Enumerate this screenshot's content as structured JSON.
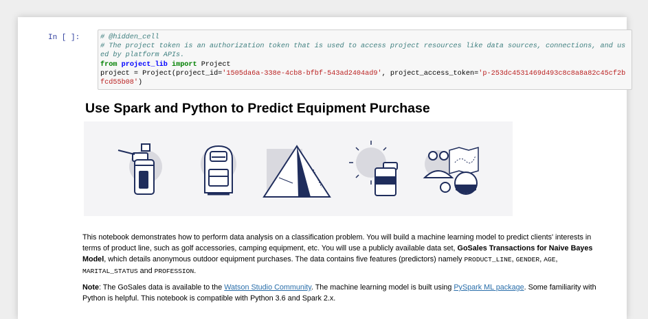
{
  "code_cell": {
    "prompt": "In [ ]:",
    "comment1": "# @hidden_cell",
    "comment2": "# The project token is an authorization token that is used to access project resources like data sources, connections, and used by platform APIs.",
    "kw_from": "from",
    "module": "project_lib",
    "kw_import": "import",
    "import_name": " Project",
    "line4_pre": "project = Project(project_id=",
    "project_id": "'1505da6a-338e-4cb8-bfbf-543ad2404ad9'",
    "line4_mid": ", project_access_token=",
    "token": "'p-253dc4531469d493c8c8a8a82c45cf2bfcd55b08'",
    "line4_end": ")"
  },
  "markdown": {
    "title": "Use Spark and Python to Predict Equipment Purchase",
    "banner_icons": [
      "golf-bag-icon",
      "backpack-icon",
      "tent-icon",
      "sun-lantern-icon",
      "map-binoculars-icon"
    ],
    "para1": {
      "t1": "This notebook demonstrates how to perform data analysis on a classification problem. You will build a machine learning model to predict clients' interests in terms of product line, such as golf accessories, camping equipment, etc. You will use a publicly available data set, ",
      "bold": "GoSales Transactions for Naive Bayes Model",
      "t2": ", which details anonymous outdoor equipment purchases. The data contains five features (predictors) namely ",
      "f1": "PRODUCT_LINE",
      "sep1": ", ",
      "f2": "GENDER",
      "sep2": ", ",
      "f3": "AGE",
      "sep3": ", ",
      "f4": "MARITAL_STATUS",
      "and": " and ",
      "f5": "PROFESSION",
      "end": "."
    },
    "para2": {
      "note": "Note",
      "t1": ": The GoSales data is available to the ",
      "link1": "Watson Studio Community",
      "t2": ". The machine learning model is built using ",
      "link2": "PySpark ML package",
      "t3": ". Some familiarity with Python is helpful. This notebook is compatible with Python 3.6 and Spark 2.x."
    }
  },
  "colors": {
    "prompt": "#303f9f",
    "comment": "#408080",
    "keyword": "#008000",
    "string": "#ba2121",
    "icon_navy": "#1f2d5c",
    "icon_gray": "#d9d9df",
    "link": "#296eaa"
  }
}
